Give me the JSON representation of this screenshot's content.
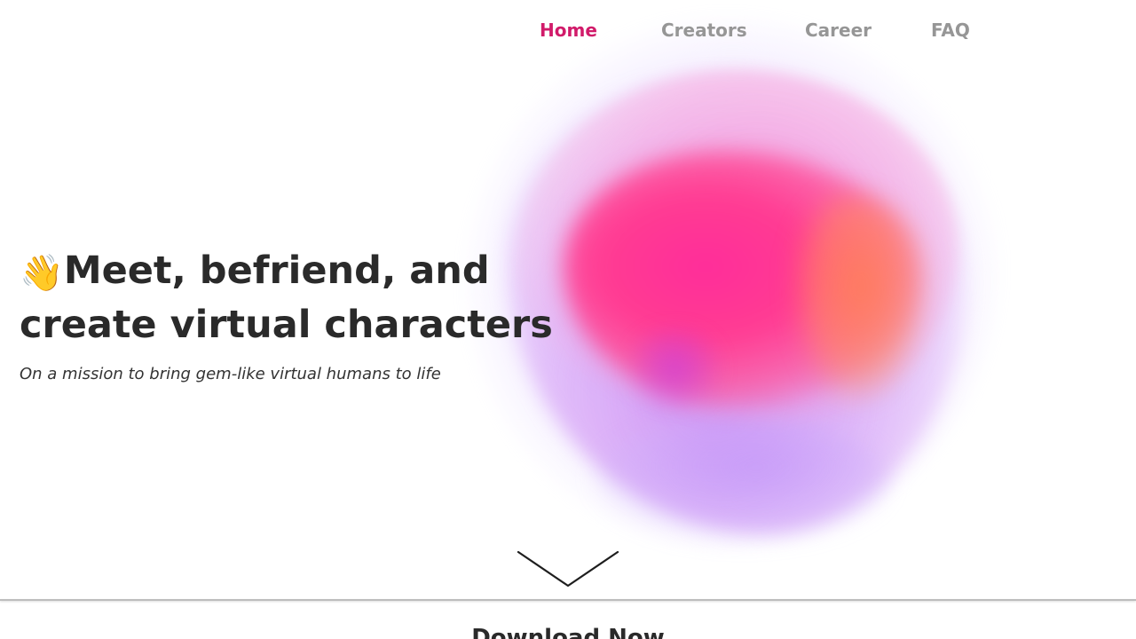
{
  "nav": {
    "items": [
      {
        "label": "Home",
        "active": true
      },
      {
        "label": "Creators",
        "active": false
      },
      {
        "label": "Career",
        "active": false
      },
      {
        "label": "FAQ",
        "active": false
      }
    ],
    "active_color": "#d11b6a",
    "inactive_color": "#969696"
  },
  "hero": {
    "wave_emoji": "👋",
    "title_line1": "Meet, befriend, and",
    "title_line2": "create virtual characters",
    "subtitle": "On a mission to bring gem-like virtual humans to life"
  },
  "scroll": {
    "icon": "chevron-down-icon"
  },
  "download": {
    "title": "Download Now"
  },
  "colors": {
    "heading": "#2a2a2a",
    "blob_pink": "#ff2d9a",
    "blob_orange": "#ff8250",
    "blob_violet": "#c478f0"
  }
}
